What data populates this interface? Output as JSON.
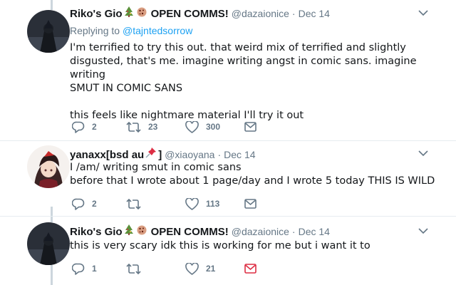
{
  "tweets": [
    {
      "name": "Riko's Gio",
      "name_suffix": "OPEN COMMS!",
      "handle": "@dazaionice",
      "date": "Dec 14",
      "reply_label": "Replying to",
      "reply_handle": "@tajntedsorrow",
      "text": "I'm terrified to try this out. that weird mix of terrified and slightly\ndisgusted, that's me. imagine writing angst in comic sans. imagine writing\nSMUT IN COMIC SANS\n\nthis feels like nightmare material I'll try it out",
      "replies": "2",
      "retweets": "23",
      "likes": "300"
    },
    {
      "name": "yanaxx[bsd au",
      "name_suffix": "]",
      "handle": "@xiaoyana",
      "date": "Dec 14",
      "text": "I /am/ writing smut in comic sans\nbefore that I wrote about 1 page/day and I wrote 5 today THIS IS WILD",
      "replies": "2",
      "retweets": "",
      "likes": "113"
    },
    {
      "name": "Riko's Gio",
      "name_suffix": "OPEN COMMS!",
      "handle": "@dazaionice",
      "date": "Dec 14",
      "text": "this is very scary idk this is working for me but i want it to",
      "replies": "1",
      "retweets": "",
      "likes": "21"
    }
  ],
  "dot": "·",
  "colors": {
    "link": "#1da1f2",
    "muted": "#657786",
    "divider": "#e6ecf0"
  },
  "icons": [
    "chevron-down-icon",
    "reply-icon",
    "retweet-icon",
    "like-icon",
    "message-icon",
    "tree-emoji",
    "cookie-emoji",
    "pushpin-emoji"
  ]
}
